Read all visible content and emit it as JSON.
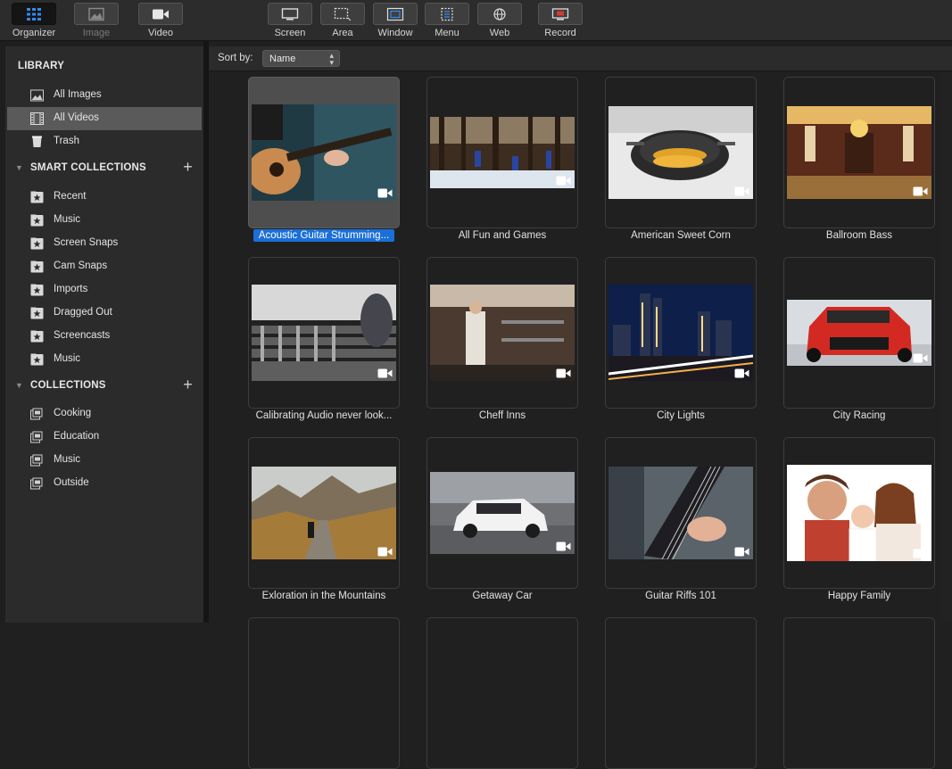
{
  "toolbar": {
    "left": [
      {
        "label": "Organizer",
        "icon": "grid-icon",
        "active": true
      },
      {
        "label": "Image",
        "icon": "image-icon",
        "disabled": true
      },
      {
        "label": "Video",
        "icon": "video-camera-icon"
      }
    ],
    "capture": [
      {
        "label": "Screen",
        "icon": "screen-capture-icon"
      },
      {
        "label": "Area",
        "icon": "area-capture-icon"
      },
      {
        "label": "Window",
        "icon": "window-capture-icon"
      },
      {
        "label": "Menu",
        "icon": "menu-capture-icon"
      },
      {
        "label": "Web",
        "icon": "web-capture-icon"
      },
      {
        "label": "Record",
        "icon": "record-icon"
      }
    ]
  },
  "sidebar": {
    "library": {
      "title": "LIBRARY",
      "items": [
        {
          "label": "All Images",
          "icon": "images-icon"
        },
        {
          "label": "All Videos",
          "icon": "film-icon",
          "selected": true
        },
        {
          "label": "Trash",
          "icon": "trash-icon"
        }
      ]
    },
    "smart_collections": {
      "title": "SMART COLLECTIONS",
      "items": [
        "Recent",
        "Music",
        "Screen Snaps",
        "Cam Snaps",
        "Imports",
        "Dragged Out",
        "Screencasts",
        "Music"
      ]
    },
    "collections": {
      "title": "COLLECTIONS",
      "items": [
        "Cooking",
        "Education",
        "Music",
        "Outside"
      ]
    }
  },
  "sort": {
    "label": "Sort by:",
    "value": "Name"
  },
  "videos": [
    {
      "title": "Acoustic Guitar Strumming...",
      "selected": true
    },
    {
      "title": "All Fun and Games"
    },
    {
      "title": "American Sweet Corn"
    },
    {
      "title": "Ballroom Bass"
    },
    {
      "title": "Calibrating Audio never look..."
    },
    {
      "title": "Cheff Inns"
    },
    {
      "title": "City Lights"
    },
    {
      "title": "City Racing"
    },
    {
      "title": "Exloration in the Mountains"
    },
    {
      "title": "Getaway Car"
    },
    {
      "title": "Guitar Riffs 101"
    },
    {
      "title": "Happy Family"
    }
  ]
}
